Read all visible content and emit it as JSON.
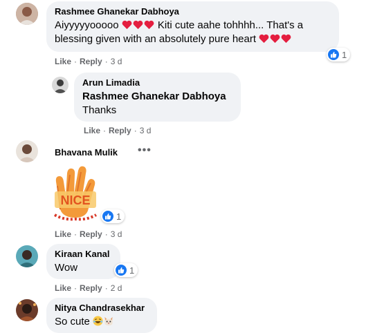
{
  "comments": [
    {
      "author": "Rashmee Ghanekar Dabhoya",
      "text_before": "Aiyyyyyooooo ",
      "text_middle": " Kiti cute aahe tohhhh... That's a",
      "text_line2": "blessing given with an absolutely pure heart ",
      "reaction_count": "1",
      "actions": {
        "like": "Like",
        "reply": "Reply",
        "time": "3 d"
      }
    },
    {
      "author": "Arun Limadia",
      "mention": "Rashmee Ghanekar Dabhoya",
      "text": "Thanks",
      "actions": {
        "like": "Like",
        "reply": "Reply",
        "time": "3 d"
      }
    },
    {
      "author": "Bhavana Mulik",
      "sticker_text": "NICE",
      "reaction_count": "1",
      "actions": {
        "like": "Like",
        "reply": "Reply",
        "time": "3 d"
      }
    },
    {
      "author": "Kiraan Kanal",
      "text": "Wow",
      "reaction_count": "1",
      "actions": {
        "like": "Like",
        "reply": "Reply",
        "time": "2 d"
      }
    },
    {
      "author": "Nitya Chandrasekhar",
      "text": "So cute "
    }
  ],
  "more_options": "•••",
  "dot_separator": "·",
  "colors": {
    "like_blue": "#1877f2",
    "bubble_bg": "#f0f2f5",
    "heart_red": "#e41e3f",
    "muted": "#65676b"
  }
}
